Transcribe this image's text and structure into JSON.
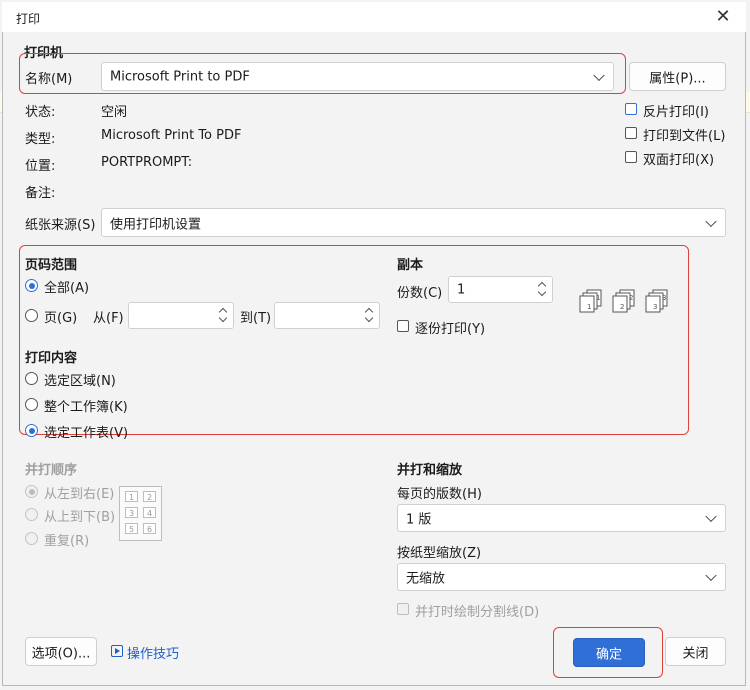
{
  "window": {
    "title": "打印"
  },
  "printer": {
    "section_title": "打印机",
    "name_label": "名称(M)",
    "name_value": "Microsoft Print to PDF",
    "properties_button": "属性(P)...",
    "status_label": "状态:",
    "status_value": "空闲",
    "type_label": "类型:",
    "type_value": "Microsoft Print To PDF",
    "location_label": "位置:",
    "location_value": "PORTPROMPT:",
    "comment_label": "备注:",
    "options": [
      {
        "label": "反片打印(I)",
        "checked": false
      },
      {
        "label": "打印到文件(L)",
        "checked": false
      },
      {
        "label": "双面打印(X)",
        "checked": false
      }
    ]
  },
  "paper_source": {
    "label": "纸张来源(S)",
    "value": "使用打印机设置"
  },
  "page_range": {
    "title": "页码范围",
    "all_label": "全部(A)",
    "pages_label": "页(G)",
    "from_label": "从(F)",
    "to_label": "到(T)",
    "selected": "all"
  },
  "print_content": {
    "title": "打印内容",
    "options": [
      {
        "label": "选定区域(N)",
        "selected": false
      },
      {
        "label": "整个工作簿(K)",
        "selected": false
      },
      {
        "label": "选定工作表(V)",
        "selected": true
      }
    ]
  },
  "copies": {
    "title": "副本",
    "count_label": "份数(C)",
    "count_value": "1",
    "collate_label": "逐份打印(Y)",
    "collate_checked": false
  },
  "print_order": {
    "title": "并打顺序",
    "options": [
      {
        "label": "从左到右(E)",
        "selected": true
      },
      {
        "label": "从上到下(B)",
        "selected": false
      },
      {
        "label": "重复(R)",
        "selected": false
      }
    ],
    "grid_numbers": [
      "1",
      "2",
      "3",
      "4",
      "5",
      "6"
    ]
  },
  "merge_scale": {
    "title": "并打和缩放",
    "pages_per_sheet_label": "每页的版数(H)",
    "pages_per_sheet_value": "1 版",
    "scale_label": "按纸型缩放(Z)",
    "scale_value": "无缩放",
    "draw_lines_label": "并打时绘制分割线(D)"
  },
  "footer": {
    "options_button": "选项(O)...",
    "tips_link": "操作技巧",
    "ok_button": "确定",
    "close_button": "关闭"
  },
  "colors": {
    "accent": "#2f6fd6",
    "highlight": "#e0403c"
  }
}
